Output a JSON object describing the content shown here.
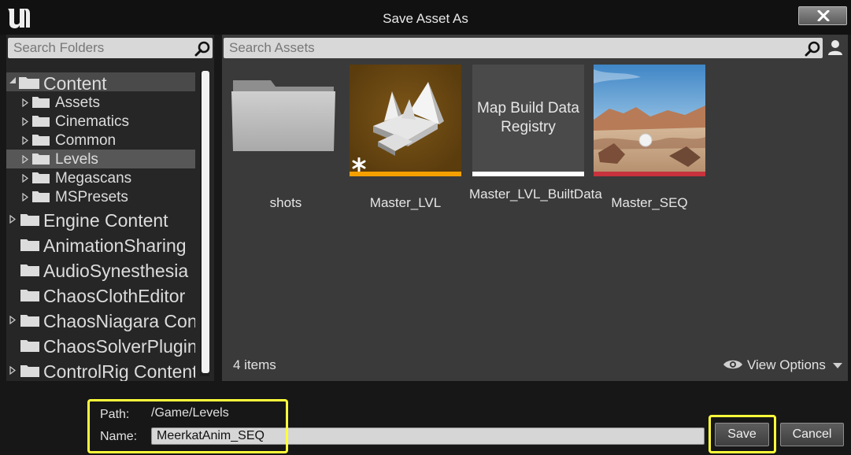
{
  "window": {
    "title": "Save Asset As",
    "close_icon": "close-icon",
    "logo_icon": "unreal-logo-icon"
  },
  "folders": {
    "search_placeholder": "Search Folders",
    "tree": [
      {
        "label": "Content",
        "level": 0,
        "expanded": true
      },
      {
        "label": "Assets",
        "level": 1
      },
      {
        "label": "Cinematics",
        "level": 1
      },
      {
        "label": "Common",
        "level": 1
      },
      {
        "label": "Levels",
        "level": 1,
        "selected": true
      },
      {
        "label": "Megascans",
        "level": 1
      },
      {
        "label": "MSPresets",
        "level": 1
      },
      {
        "label": "Engine Content",
        "level": 0
      },
      {
        "label": "AnimationSharing",
        "level": 0
      },
      {
        "label": "AudioSynesthesia",
        "level": 0
      },
      {
        "label": "ChaosClothEditor",
        "level": 0
      },
      {
        "label": "ChaosNiagara Content",
        "level": 0
      },
      {
        "label": "ChaosSolverPlugin",
        "level": 0
      },
      {
        "label": "ControlRig Content",
        "level": 0
      }
    ]
  },
  "assets": {
    "search_placeholder": "Search Assets",
    "items": [
      {
        "name": "shots",
        "kind": "folder"
      },
      {
        "name": "Master_LVL",
        "kind": "level",
        "accent": "#f5a000"
      },
      {
        "name": "Master_LVL_BuiltData",
        "kind": "map-build-data",
        "thumb_text": "Map Build Data Registry",
        "accent": "#ffffff"
      },
      {
        "name": "Master_SEQ",
        "kind": "level-sequence",
        "accent": "#c8323c"
      }
    ],
    "count_text": "4 items",
    "view_options_label": "View Options"
  },
  "save": {
    "path_label": "Path:",
    "path_value": "/Game/Levels",
    "name_label": "Name:",
    "name_value": "MeerkatAnim_SEQ",
    "save_label": "Save",
    "cancel_label": "Cancel"
  },
  "colors": {
    "highlight": "#ffff3a"
  }
}
